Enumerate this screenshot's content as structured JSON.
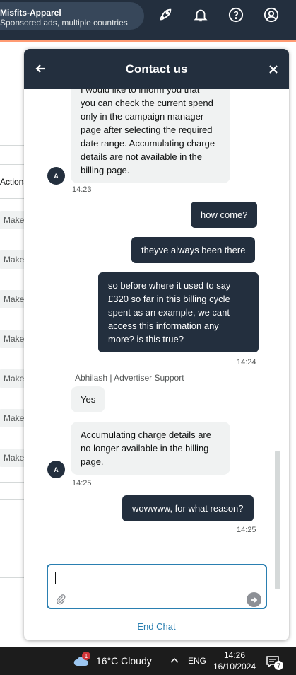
{
  "topbar": {
    "account_name": "Misfits-Apparel",
    "account_sub": "Sponsored ads, multiple countries",
    "icons": [
      "rocket-icon",
      "bell-icon",
      "help-icon",
      "account-icon"
    ]
  },
  "background": {
    "actions_header": "Actions",
    "make_label": "Make"
  },
  "chat": {
    "title": "Contact us",
    "messages": [
      {
        "from": "agent",
        "avatar": "A",
        "text_lines": [
          "I would like to inform you that",
          "you can check the current spend",
          "only in the campaign manager",
          "page after selecting the required",
          "date range. Accumulating charge",
          "details are not available in the",
          "billing page."
        ],
        "time": "14:23"
      },
      {
        "from": "user",
        "text": "how come?"
      },
      {
        "from": "user",
        "text": "theyve always been there"
      },
      {
        "from": "user",
        "text_lines": [
          "so before where it used to say",
          "£320 so far in this billing cycle",
          "spent as an example, we cant",
          "access this information any",
          "more? is this true?"
        ],
        "time": "14:24"
      },
      {
        "from": "agent",
        "sender": "Abhilash | Advertiser Support",
        "text": "Yes"
      },
      {
        "from": "agent",
        "avatar": "A",
        "text_lines": [
          "Accumulating charge details are",
          "no longer available in the billing",
          "page."
        ],
        "time": "14:25"
      },
      {
        "from": "user",
        "text": "wowwww, for what reason?",
        "time": "14:25"
      }
    ],
    "input_value": "",
    "end_chat_label": "End Chat"
  },
  "taskbar": {
    "weather_badge": "1",
    "weather": "16°C  Cloudy",
    "language": "ENG",
    "time": "14:26",
    "date": "16/10/2024",
    "notification_count": "7"
  },
  "colors": {
    "header_bg": "#232f3e",
    "accent_line": "#ff9b73",
    "link_blue": "#2a7fb1",
    "bubble_in": "#f0f2f2"
  }
}
